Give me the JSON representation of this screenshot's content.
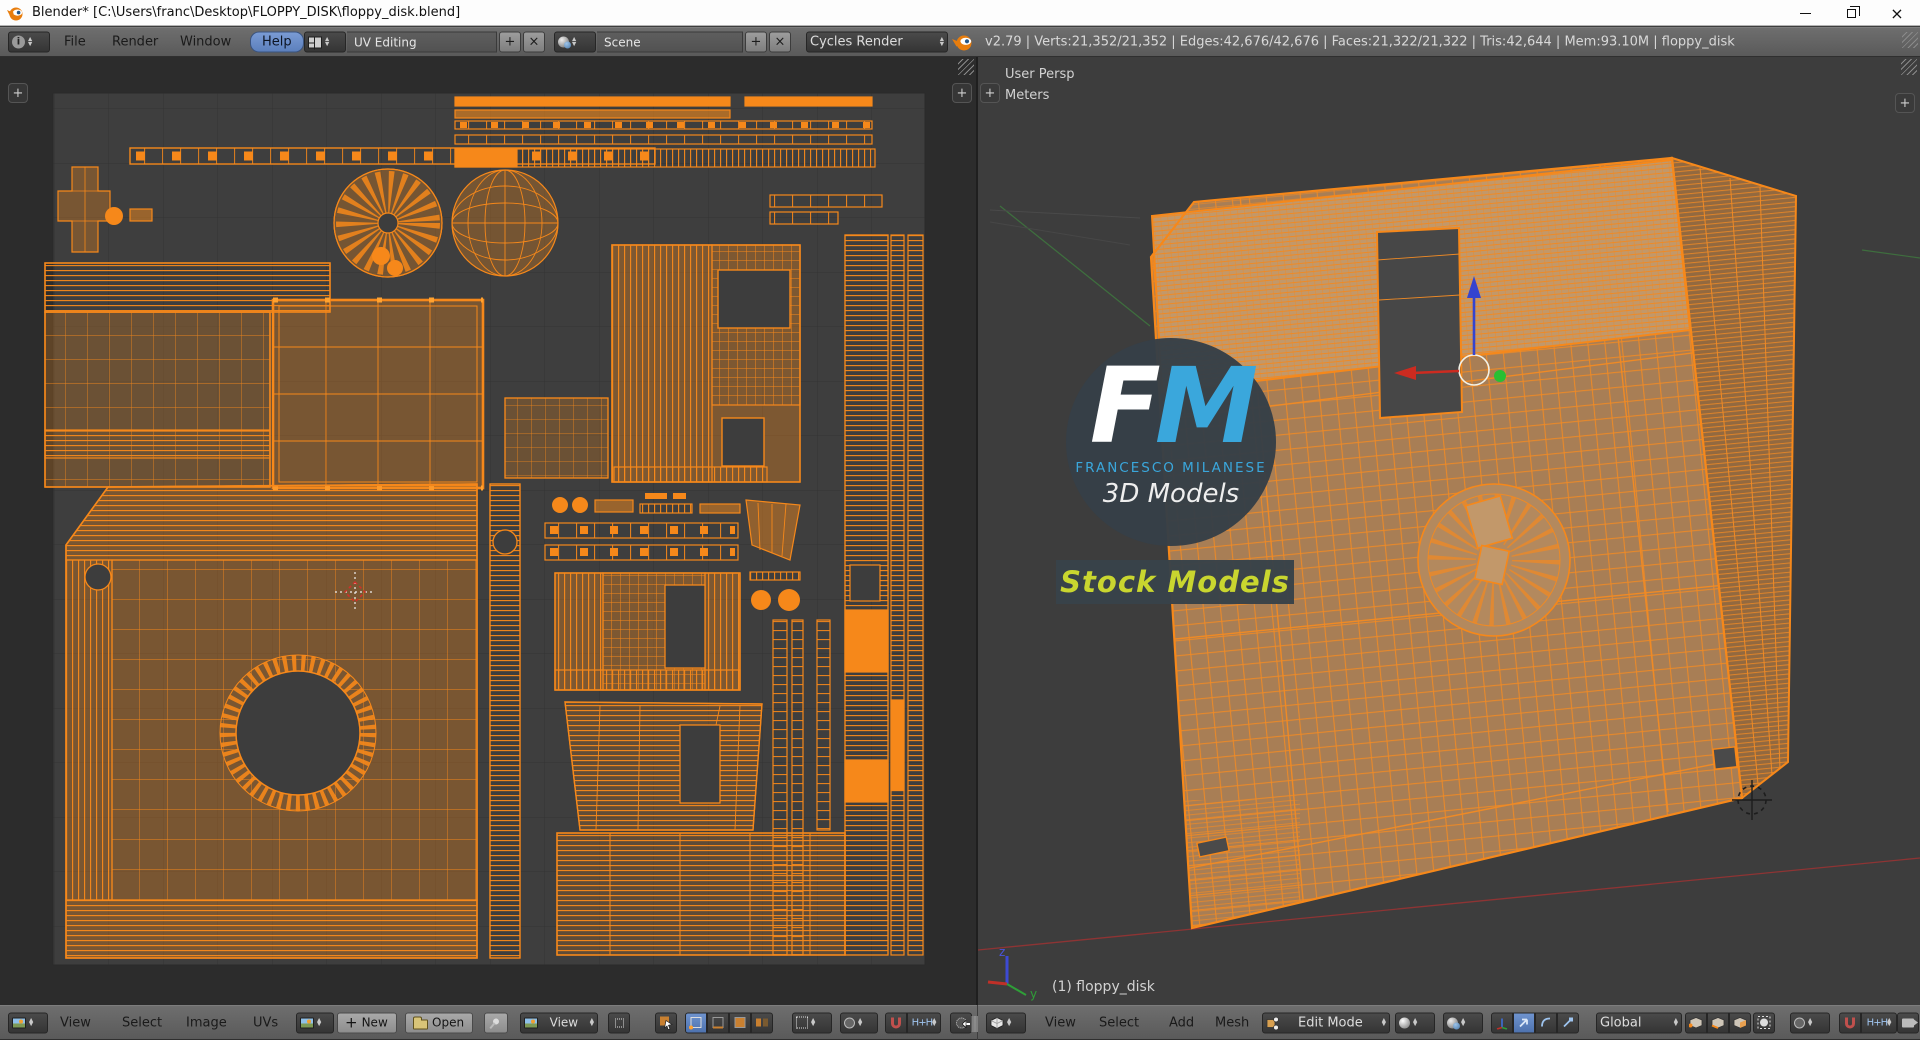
{
  "window": {
    "title": "Blender* [C:\\Users\\franc\\Desktop\\FLOPPY_DISK\\floppy_disk.blend]"
  },
  "header": {
    "menus": {
      "file": "File",
      "render": "Render",
      "window": "Window",
      "help": "Help"
    },
    "screen_layout": "UV Editing",
    "scene": "Scene",
    "render_engine": "Cycles Render",
    "stats": "v2.79 | Verts:21,352/21,352 | Edges:42,676/42,676 | Faces:21,322/21,322 | Tris:42,644 | Mem:93.10M | floppy_disk"
  },
  "uv_editor": {
    "menus": {
      "view": "View",
      "select": "Select",
      "image": "Image",
      "uvs": "UVs"
    },
    "new_button": "New",
    "open_button": "Open",
    "display_dropdown": "View"
  },
  "viewport": {
    "view_label": "User Persp",
    "units_label": "Meters",
    "object_label": "(1) floppy_disk",
    "menus": {
      "view": "View",
      "select": "Select",
      "add": "Add",
      "mesh": "Mesh"
    },
    "mode": "Edit Mode",
    "orientation": "Global",
    "axis": {
      "z": "z",
      "y": "y"
    }
  },
  "logo": {
    "f": "F",
    "m": "M",
    "name": "FRANCESCO MILANESE",
    "tagline": "3D Models",
    "badge": "Stock Models"
  },
  "colors": {
    "accent_orange": "#f6881a",
    "selection_blue": "#5c80bd",
    "logo_blue": "#3aa7dc",
    "badge_yellow": "#c9d62f",
    "viewport_bg": "#3d3d3d"
  }
}
